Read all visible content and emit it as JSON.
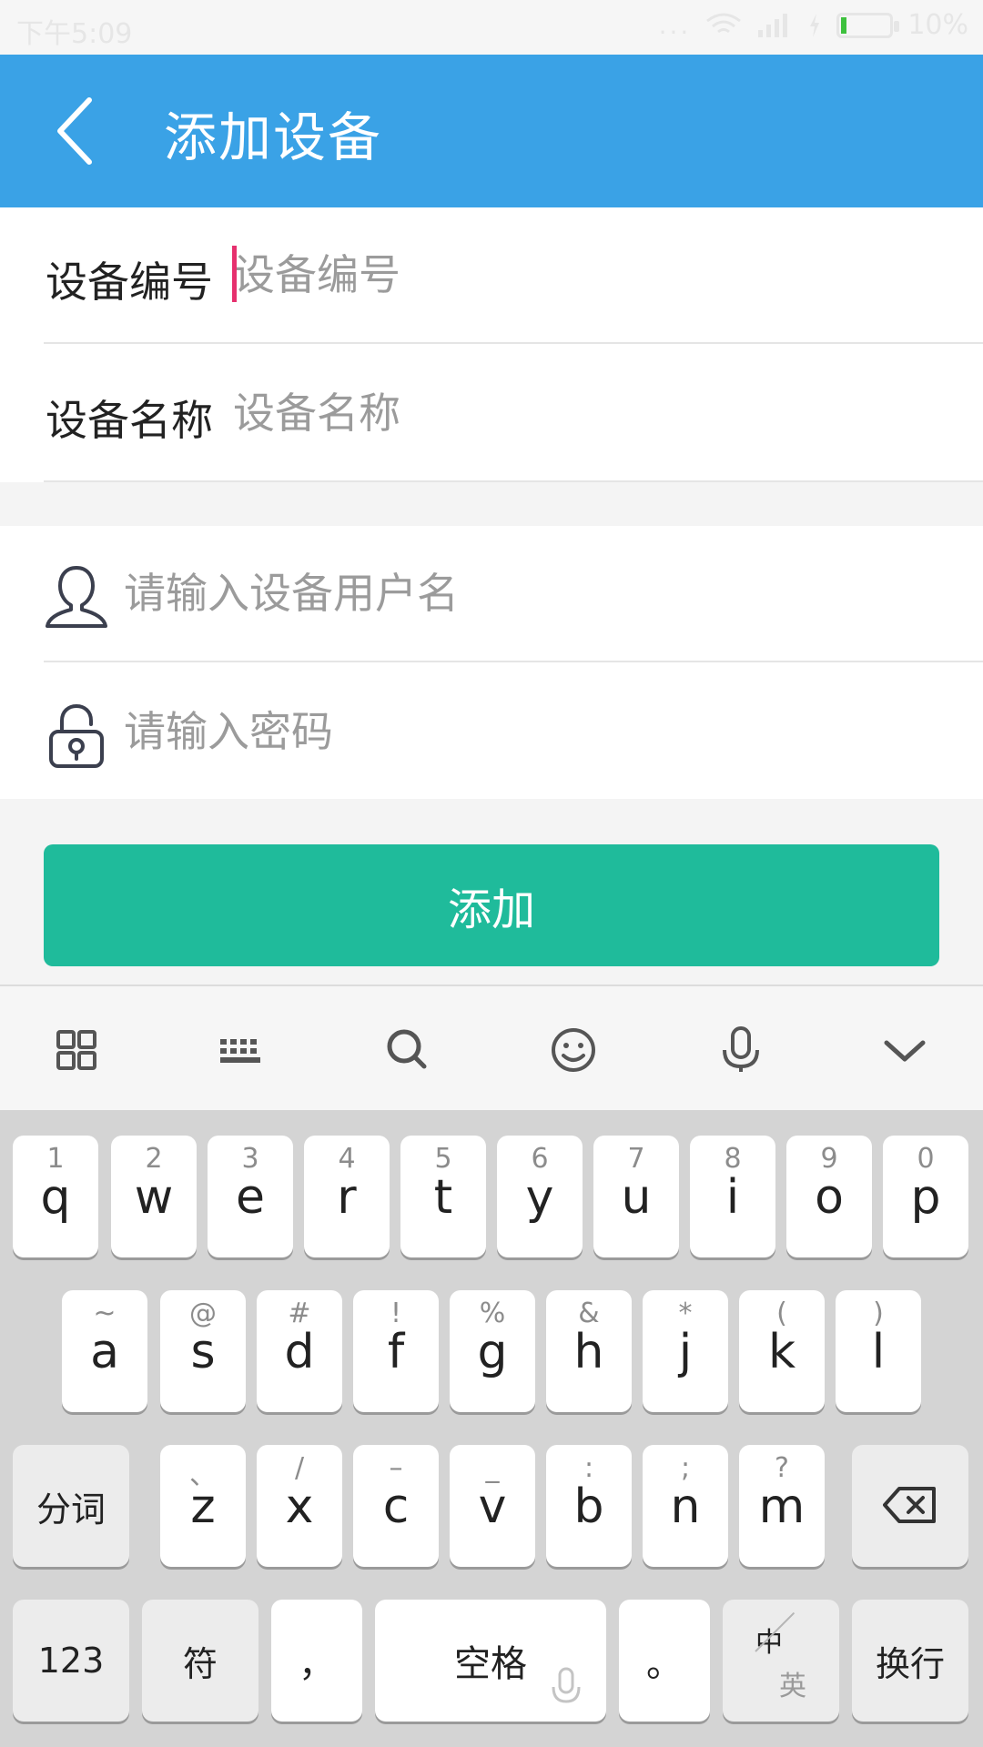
{
  "status": {
    "time": "下午5:09",
    "dots": "...",
    "battery": "10%"
  },
  "header": {
    "title": "添加设备"
  },
  "form": {
    "device_id": {
      "label": "设备编号",
      "placeholder": "设备编号"
    },
    "device_name": {
      "label": "设备名称",
      "placeholder": "设备名称"
    },
    "username": {
      "placeholder": "请输入设备用户名",
      "icon": "user-icon"
    },
    "password": {
      "placeholder": "请输入密码",
      "icon": "lock-icon"
    }
  },
  "actions": {
    "add_label": "添加"
  },
  "keyboard": {
    "toolbar": [
      "grid-icon",
      "keyboard-icon",
      "search-icon",
      "emoji-icon",
      "microphone-icon",
      "chevron-down-icon"
    ],
    "row1": [
      {
        "hint": "1",
        "key": "q"
      },
      {
        "hint": "2",
        "key": "w"
      },
      {
        "hint": "3",
        "key": "e"
      },
      {
        "hint": "4",
        "key": "r"
      },
      {
        "hint": "5",
        "key": "t"
      },
      {
        "hint": "6",
        "key": "y"
      },
      {
        "hint": "7",
        "key": "u"
      },
      {
        "hint": "8",
        "key": "i"
      },
      {
        "hint": "9",
        "key": "o"
      },
      {
        "hint": "0",
        "key": "p"
      }
    ],
    "row2": [
      {
        "hint": "~",
        "key": "a"
      },
      {
        "hint": "@",
        "key": "s"
      },
      {
        "hint": "#",
        "key": "d"
      },
      {
        "hint": "!",
        "key": "f"
      },
      {
        "hint": "%",
        "key": "g"
      },
      {
        "hint": "&",
        "key": "h"
      },
      {
        "hint": "*",
        "key": "j"
      },
      {
        "hint": "(",
        "key": "k"
      },
      {
        "hint": ")",
        "key": "l"
      }
    ],
    "row3": [
      {
        "hint": "、",
        "key": "z"
      },
      {
        "hint": "/",
        "key": "x"
      },
      {
        "hint": "–",
        "key": "c"
      },
      {
        "hint": "_",
        "key": "v"
      },
      {
        "hint": ":",
        "key": "b"
      },
      {
        "hint": ";",
        "key": "n"
      },
      {
        "hint": "?",
        "key": "m"
      }
    ],
    "fenci": "分词",
    "num": "123",
    "fu": "符",
    "comma": "，",
    "space": "空格",
    "period": "。",
    "zh": "中",
    "en": "英",
    "enter": "换行"
  }
}
